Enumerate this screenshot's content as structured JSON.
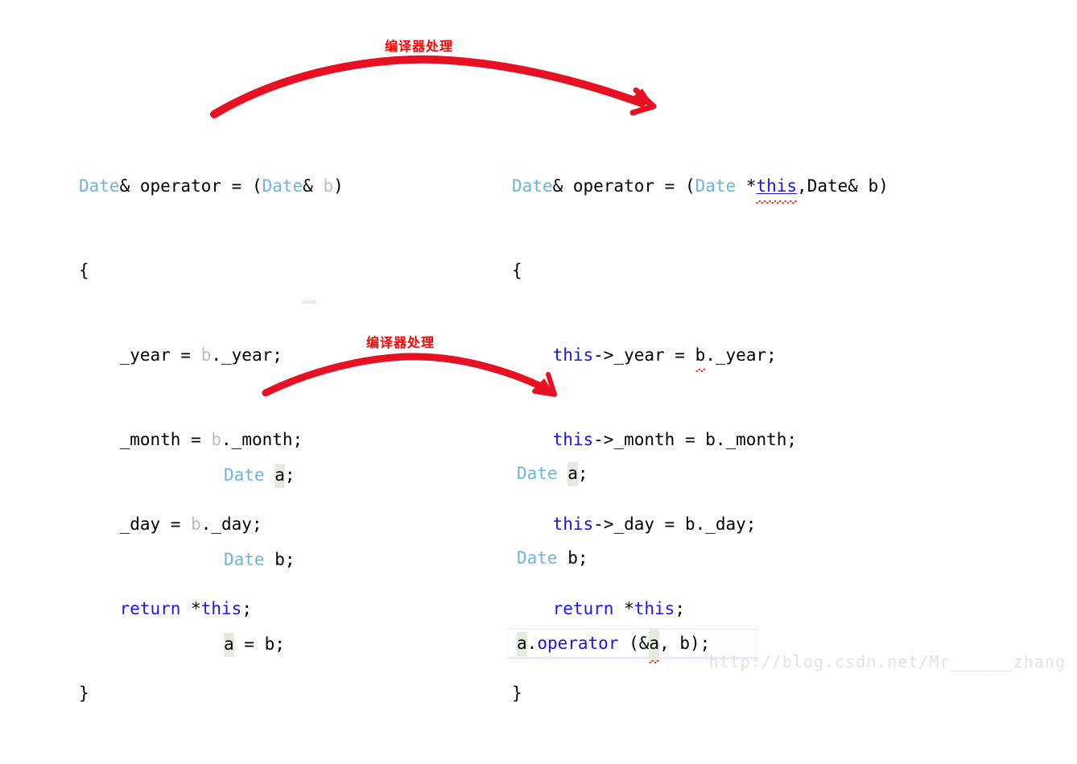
{
  "annotations": [
    {
      "id": "top",
      "text": "编译器处理",
      "color": "#ff0000"
    },
    {
      "id": "bottom",
      "text": "编译器处理",
      "color": "#ff0000"
    }
  ],
  "colors": {
    "type_token": "#6cb4dc",
    "keyword_token": "#1b14f0",
    "dim_identifier": "#bdbdbd",
    "plain_text": "#000000",
    "annotation_red": "#ff0000",
    "arrow_red": "#e81123",
    "occurrence_highlight": "#e7eade",
    "watermark": "#e2e2e2",
    "squiggle_red": "#ff2d1e",
    "caret": "#6a6a6a",
    "background": "#ffffff"
  },
  "code_blocks": {
    "top_left": {
      "title": "user-written assignment operator",
      "lines": [
        {
          "id": "tl-0",
          "tokens": [
            {
              "text": "Date",
              "style": "type"
            },
            {
              "text": "& operator = (",
              "style": "plain"
            },
            {
              "text": "Date",
              "style": "type"
            },
            {
              "text": "& ",
              "style": "plain"
            },
            {
              "text": "b",
              "style": "dim"
            },
            {
              "text": ")",
              "style": "plain"
            }
          ]
        },
        {
          "id": "tl-1",
          "tokens": [
            {
              "text": "{",
              "style": "plain"
            }
          ]
        },
        {
          "id": "tl-2",
          "tokens": [
            {
              "text": "    _year = ",
              "style": "plain"
            },
            {
              "text": "b",
              "style": "dim"
            },
            {
              "text": "._year;",
              "style": "plain"
            }
          ]
        },
        {
          "id": "tl-3",
          "tokens": [
            {
              "text": "    _month = ",
              "style": "plain"
            },
            {
              "text": "b",
              "style": "dim"
            },
            {
              "text": "._month;",
              "style": "plain"
            }
          ]
        },
        {
          "id": "tl-4",
          "tokens": [
            {
              "text": "    _day = ",
              "style": "plain"
            },
            {
              "text": "b",
              "style": "dim"
            },
            {
              "text": "._day;",
              "style": "plain"
            }
          ]
        },
        {
          "id": "tl-5",
          "tokens": [
            {
              "text": "    ",
              "style": "plain"
            },
            {
              "text": "return",
              "style": "kw"
            },
            {
              "text": " *",
              "style": "plain"
            },
            {
              "text": "this",
              "style": "kw"
            },
            {
              "text": ";",
              "style": "plain"
            }
          ]
        },
        {
          "id": "tl-6",
          "tokens": [
            {
              "text": "}",
              "style": "plain"
            }
          ]
        }
      ]
    },
    "top_right": {
      "title": "compiler-expanded form with explicit this",
      "lines": [
        {
          "id": "tr-0",
          "tokens": [
            {
              "text": "Date",
              "style": "type"
            },
            {
              "text": "& operator = (",
              "style": "plain"
            },
            {
              "text": "Date",
              "style": "type"
            },
            {
              "text": " *",
              "style": "plain"
            },
            {
              "text": "this",
              "style": "this-underline-squiggle"
            },
            {
              "text": ",",
              "style": "plain"
            },
            {
              "text": "Date",
              "style": "plain"
            },
            {
              "text": "& b)",
              "style": "plain"
            }
          ]
        },
        {
          "id": "tr-1",
          "tokens": [
            {
              "text": "{",
              "style": "plain"
            }
          ]
        },
        {
          "id": "tr-2",
          "tokens": [
            {
              "text": "    ",
              "style": "plain"
            },
            {
              "text": "this",
              "style": "kw"
            },
            {
              "text": "->_year = ",
              "style": "plain"
            },
            {
              "text": "b",
              "style": "squiggle"
            },
            {
              "text": "._year;",
              "style": "plain"
            }
          ]
        },
        {
          "id": "tr-3",
          "tokens": [
            {
              "text": "    ",
              "style": "plain"
            },
            {
              "text": "this",
              "style": "kw"
            },
            {
              "text": "->_month = b._month;",
              "style": "plain"
            }
          ]
        },
        {
          "id": "tr-4",
          "tokens": [
            {
              "text": "    ",
              "style": "plain"
            },
            {
              "text": "this",
              "style": "kw"
            },
            {
              "text": "->_day = b._day;",
              "style": "plain"
            }
          ]
        },
        {
          "id": "tr-5",
          "tokens": [
            {
              "text": "    ",
              "style": "plain"
            },
            {
              "text": "return",
              "style": "kw"
            },
            {
              "text": " *",
              "style": "plain"
            },
            {
              "text": "this",
              "style": "kw"
            },
            {
              "text": ";",
              "style": "plain"
            }
          ]
        },
        {
          "id": "tr-6",
          "tokens": [
            {
              "text": "}",
              "style": "plain"
            }
          ]
        }
      ]
    },
    "bottom_left": {
      "title": "call site as written",
      "lines": [
        {
          "id": "bl-0",
          "tokens": [
            {
              "text": "Date",
              "style": "type"
            },
            {
              "text": " ",
              "style": "plain"
            },
            {
              "text": "a",
              "style": "highlight"
            },
            {
              "text": ";",
              "style": "plain"
            }
          ]
        },
        {
          "id": "bl-1",
          "tokens": [
            {
              "text": "Date",
              "style": "type"
            },
            {
              "text": " b;",
              "style": "plain"
            }
          ]
        },
        {
          "id": "bl-2",
          "tokens": [
            {
              "text": "a",
              "style": "highlight"
            },
            {
              "text": " = b;",
              "style": "plain"
            }
          ]
        }
      ]
    },
    "bottom_right": {
      "title": "call site after compiler rewrite",
      "lines": [
        {
          "id": "br-0",
          "tokens": [
            {
              "text": "Date",
              "style": "type"
            },
            {
              "text": " ",
              "style": "plain"
            },
            {
              "text": "a",
              "style": "highlight"
            },
            {
              "text": ";",
              "style": "plain"
            }
          ]
        },
        {
          "id": "br-1",
          "tokens": [
            {
              "text": "Date",
              "style": "type"
            },
            {
              "text": " b;",
              "style": "plain"
            }
          ]
        },
        {
          "id": "br-2",
          "current_line": true,
          "caret": true,
          "tokens": [
            {
              "text": "a",
              "style": "highlight"
            },
            {
              "text": ".",
              "style": "plain"
            },
            {
              "text": "operator",
              "style": "func"
            },
            {
              "text": " (&",
              "style": "plain"
            },
            {
              "text": "a",
              "style": "highlight-squiggle"
            },
            {
              "text": ", b);",
              "style": "plain"
            }
          ]
        }
      ]
    }
  },
  "watermark": {
    "text": "http://blog.csdn.net/Mr______zhang"
  }
}
